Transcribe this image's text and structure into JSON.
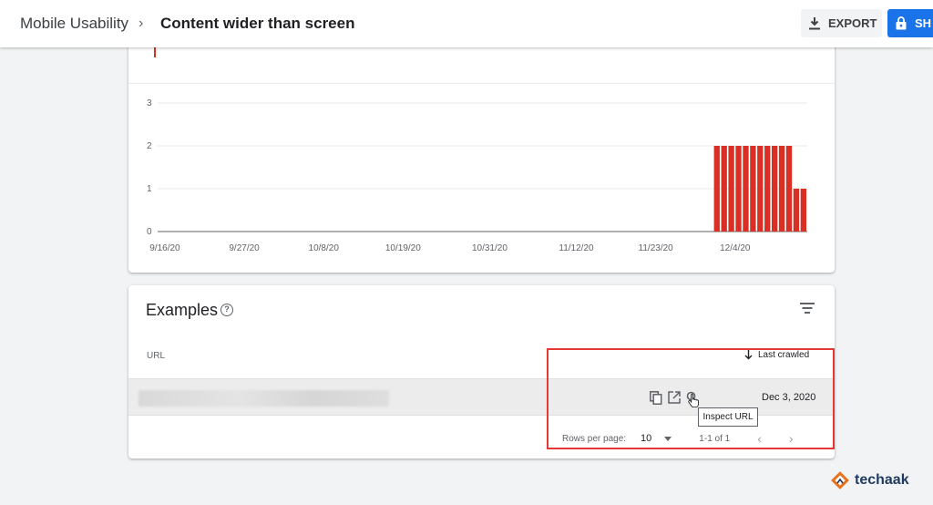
{
  "header": {
    "breadcrumb_parent": "Mobile Usability",
    "breadcrumb_separator": "›",
    "breadcrumb_current": "Content wider than screen",
    "export_label": "EXPORT",
    "share_label": "SH"
  },
  "colors": {
    "bar": "#d93025",
    "accent": "#1a73e8",
    "highlight": "#e53935"
  },
  "chart_data": {
    "type": "bar",
    "y_ticks": [
      "0",
      "1",
      "2",
      "3"
    ],
    "ylim": [
      0,
      3
    ],
    "x_tick_labels": [
      "9/16/20",
      "9/27/20",
      "10/8/20",
      "10/19/20",
      "10/31/20",
      "11/12/20",
      "11/23/20",
      "12/4/20"
    ],
    "x_tick_dates": [
      "2020-09-16",
      "2020-09-27",
      "2020-10-08",
      "2020-10-19",
      "2020-10-31",
      "2020-11-12",
      "2020-11-23",
      "2020-12-04"
    ],
    "x_range": [
      "2020-09-15",
      "2020-12-14"
    ],
    "bars": [
      {
        "date": "2020-12-01",
        "value": 2
      },
      {
        "date": "2020-12-02",
        "value": 2
      },
      {
        "date": "2020-12-03",
        "value": 2
      },
      {
        "date": "2020-12-04",
        "value": 2
      },
      {
        "date": "2020-12-05",
        "value": 2
      },
      {
        "date": "2020-12-06",
        "value": 2
      },
      {
        "date": "2020-12-07",
        "value": 2
      },
      {
        "date": "2020-12-08",
        "value": 2
      },
      {
        "date": "2020-12-09",
        "value": 2
      },
      {
        "date": "2020-12-10",
        "value": 2
      },
      {
        "date": "2020-12-11",
        "value": 2
      },
      {
        "date": "2020-12-12",
        "value": 1
      },
      {
        "date": "2020-12-13",
        "value": 1
      }
    ]
  },
  "examples": {
    "title": "Examples",
    "col_url": "URL",
    "col_last_crawled": "Last crawled",
    "rows": [
      {
        "url": "",
        "last_crawled": "Dec 3, 2020"
      }
    ],
    "tooltip": "Inspect URL",
    "rows_per_page_label": "Rows per page:",
    "rows_per_page_value": "10",
    "range_label": "1-1 of 1",
    "prev": "‹",
    "next": "›"
  },
  "brand": {
    "name": "techaak"
  }
}
